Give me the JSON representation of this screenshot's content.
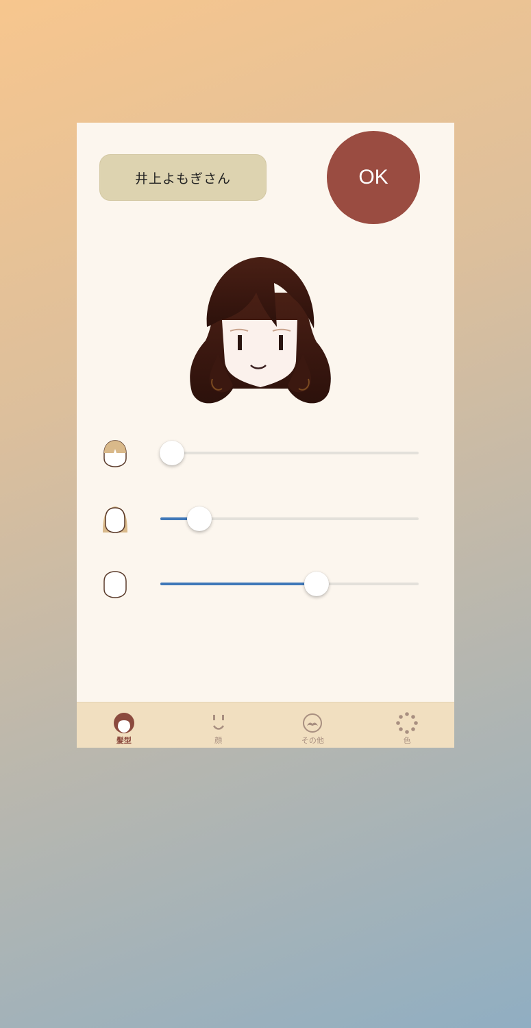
{
  "header": {
    "user_name": "井上よもぎさん",
    "ok_label": "OK"
  },
  "sliders": [
    {
      "icon": "bangs-length-icon",
      "value": 0.045
    },
    {
      "icon": "side-hair-icon",
      "value": 0.15
    },
    {
      "icon": "face-shape-icon",
      "value": 0.605
    }
  ],
  "tabs": [
    {
      "label": "髪型",
      "icon": "hair-icon",
      "active": true
    },
    {
      "label": "顔",
      "icon": "face-icon",
      "active": false
    },
    {
      "label": "その他",
      "icon": "mustache-icon",
      "active": false
    },
    {
      "label": "色",
      "icon": "color-palette-icon",
      "active": false
    }
  ],
  "colors": {
    "accent": "#9a4c41",
    "slider_fill": "#3f77b8",
    "name_badge": "#ddd3b0",
    "tab_bar": "#f1dfc0",
    "hair": "#3b1810"
  }
}
